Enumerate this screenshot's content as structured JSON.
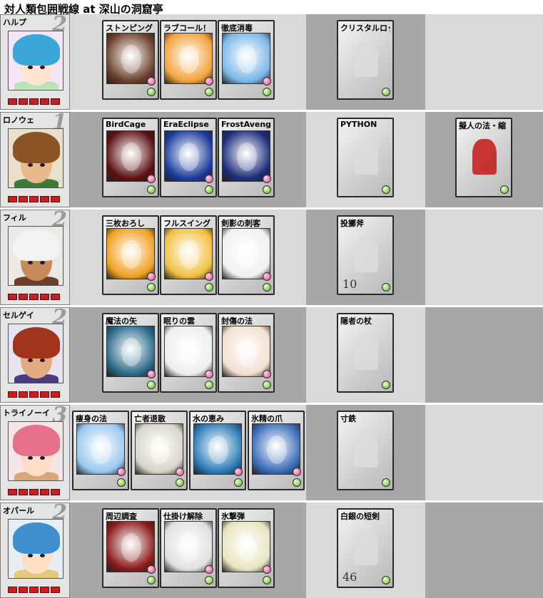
{
  "title": "対人類包囲戦線 at 深山の洞窟亭",
  "colors": {
    "cell_light": "#d9d9d9",
    "cell_dark": "#a7a7a7",
    "hp_red": "#c81e1e",
    "gem_pink": "#e0408a",
    "gem_green": "#58b81e"
  },
  "characters": [
    {
      "name": "ハルプ",
      "level": "2",
      "hp_segments": 5,
      "cards": [
        "ストンピング",
        "ラブコール！",
        "徹底消毒"
      ],
      "items": [
        {
          "name": "クリスタルロッド",
          "count": ""
        }
      ],
      "extra": []
    },
    {
      "name": "ロノウェ",
      "level": "1",
      "hp_segments": 5,
      "cards": [
        "BirdCage",
        "EraEclipse",
        "FrostAvenger"
      ],
      "items": [
        {
          "name": "PYTHON",
          "count": ""
        }
      ],
      "extra": [
        "擬人の法・縮"
      ]
    },
    {
      "name": "フィル",
      "level": "2",
      "hp_segments": 5,
      "cards": [
        "三枚おろし",
        "フルスイング",
        "剣影の刺客"
      ],
      "items": [
        {
          "name": "投擲斧",
          "count": "10"
        }
      ],
      "extra": []
    },
    {
      "name": "セルゲイ",
      "level": "2",
      "hp_segments": 5,
      "cards": [
        "魔法の矢",
        "眠りの雲",
        "封傷の法"
      ],
      "items": [
        {
          "name": "隠者の杖",
          "count": ""
        }
      ],
      "extra": []
    },
    {
      "name": "トライノーイ",
      "level": "3",
      "hp_segments": 5,
      "cards": [
        "痩身の法",
        "亡者退散",
        "水の恵み",
        "氷精の爪"
      ],
      "items": [
        {
          "name": "寸鉄",
          "count": ""
        }
      ],
      "extra": []
    },
    {
      "name": "オパール",
      "level": "2",
      "hp_segments": 5,
      "cards": [
        "周辺調査",
        "仕掛け解除",
        "氷撃弾"
      ],
      "items": [
        {
          "name": "白銀の短剣",
          "count": "46"
        }
      ],
      "extra": []
    }
  ]
}
